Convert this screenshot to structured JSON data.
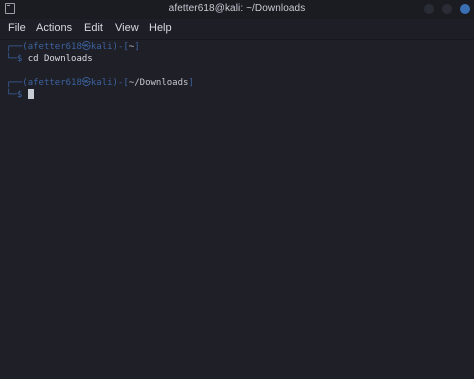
{
  "window": {
    "title": "afetter618@kali: ~/Downloads"
  },
  "menu": {
    "items": [
      "File",
      "Actions",
      "Edit",
      "View",
      "Help"
    ]
  },
  "terminal": {
    "prompt1": {
      "open": "┌──(",
      "user": "afetter618㉿kali",
      "close": ")-[",
      "path": "~",
      "end": "]",
      "symbol": "└─$ ",
      "command": "cd",
      "argument": " Downloads"
    },
    "prompt2": {
      "open": "┌──(",
      "user": "afetter618㉿kali",
      "close": ")-[",
      "path": "~/Downloads",
      "end": "]",
      "symbol": "└─$ "
    }
  }
}
